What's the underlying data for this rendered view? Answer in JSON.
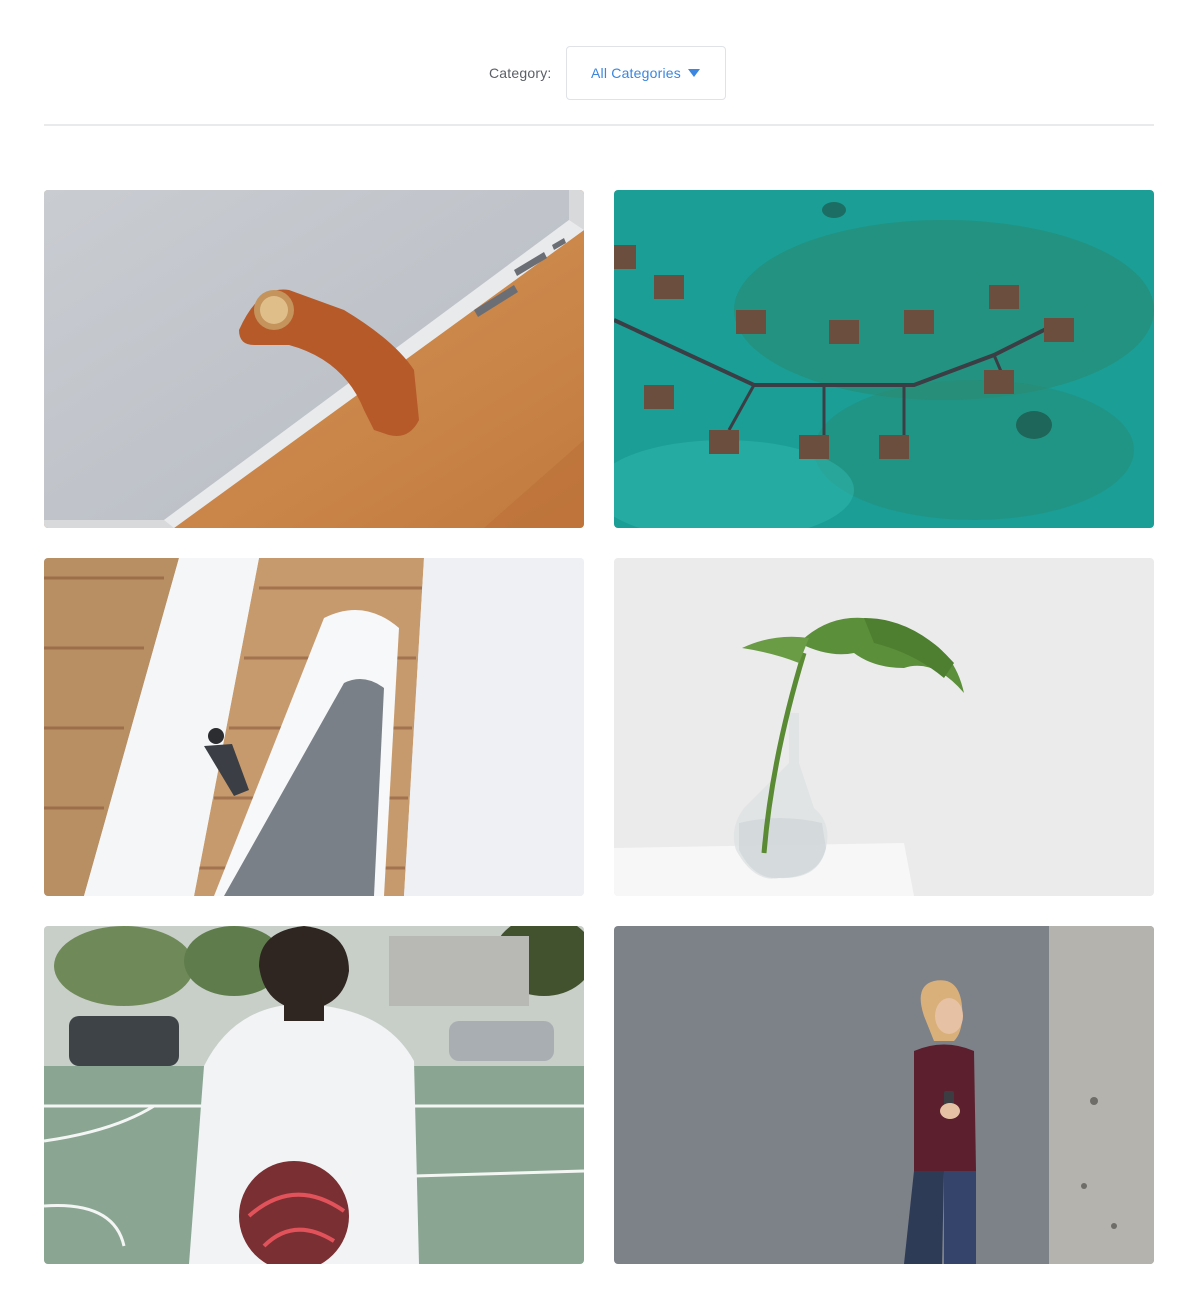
{
  "filter": {
    "label": "Category:",
    "selected": "All Categories",
    "icon": "caret-down-icon",
    "accent_color": "#3a86e0"
  },
  "gallery": {
    "items": [
      {
        "name": "felt-laptop-sleeve-photo"
      },
      {
        "name": "overwater-bungalows-aerial-photo"
      },
      {
        "name": "spiral-staircase-businessman-photo"
      },
      {
        "name": "monstera-leaf-vase-photo"
      },
      {
        "name": "basketball-player-court-photo"
      },
      {
        "name": "woman-leaning-wall-phone-photo"
      }
    ]
  }
}
